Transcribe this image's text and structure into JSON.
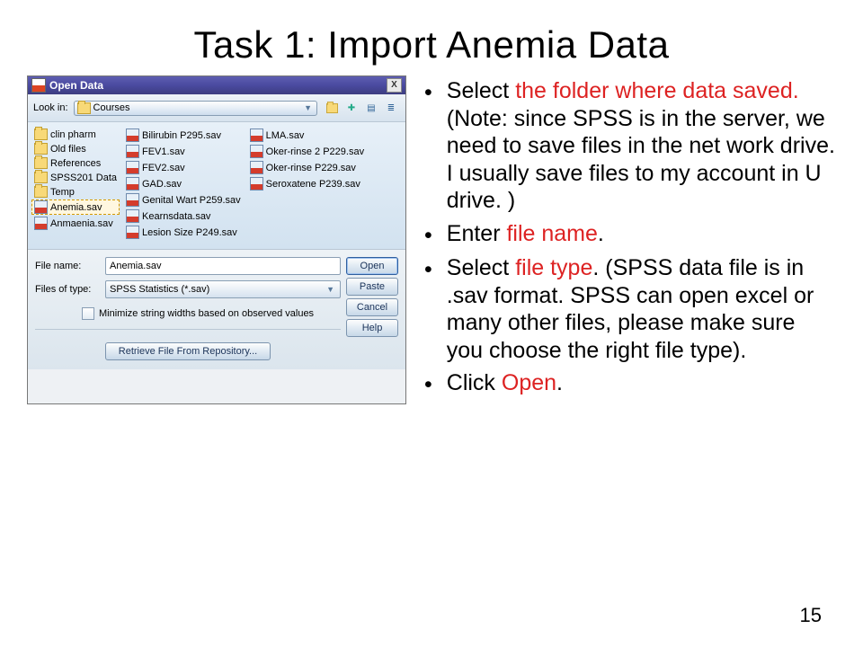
{
  "slide": {
    "title": "Task 1: Import Anemia Data",
    "page_number": "15"
  },
  "dialog": {
    "window_title": "Open Data",
    "look_in_label": "Look in:",
    "look_in_value": "Courses",
    "columns": [
      [
        {
          "name": "clin pharm",
          "type": "folder"
        },
        {
          "name": "Old files",
          "type": "folder"
        },
        {
          "name": "References",
          "type": "folder"
        },
        {
          "name": "SPSS201 Data",
          "type": "folder"
        },
        {
          "name": "Temp",
          "type": "folder"
        },
        {
          "name": "Anemia.sav",
          "type": "sav",
          "selected": true
        },
        {
          "name": "Anmaenia.sav",
          "type": "sav"
        }
      ],
      [
        {
          "name": "Bilirubin P295.sav",
          "type": "sav"
        },
        {
          "name": "FEV1.sav",
          "type": "sav"
        },
        {
          "name": "FEV2.sav",
          "type": "sav"
        },
        {
          "name": "GAD.sav",
          "type": "sav"
        },
        {
          "name": "Genital Wart P259.sav",
          "type": "sav"
        },
        {
          "name": "Kearnsdata.sav",
          "type": "sav"
        },
        {
          "name": "Lesion Size P249.sav",
          "type": "sav"
        }
      ],
      [
        {
          "name": "LMA.sav",
          "type": "sav"
        },
        {
          "name": "Oker-rinse 2 P229.sav",
          "type": "sav"
        },
        {
          "name": "Oker-rinse P229.sav",
          "type": "sav"
        },
        {
          "name": "Seroxatene P239.sav",
          "type": "sav"
        }
      ]
    ],
    "file_name_label": "File name:",
    "file_name_value": "Anemia.sav",
    "file_type_label": "Files of type:",
    "file_type_value": "SPSS Statistics (*.sav)",
    "minimize_label": "Minimize string widths based on observed values",
    "retrieve_label": "Retrieve File From Repository...",
    "buttons": {
      "open": "Open",
      "paste": "Paste",
      "cancel": "Cancel",
      "help": "Help"
    }
  },
  "bullets": [
    {
      "parts": [
        {
          "t": "Select ",
          "c": "black"
        },
        {
          "t": "the folder where data saved.",
          "c": "red"
        },
        {
          "t": " (Note: since SPSS is in the server, we need to save files in the net work drive. I usually save files to my account in U drive. )",
          "c": "black"
        }
      ]
    },
    {
      "parts": [
        {
          "t": "Enter ",
          "c": "black"
        },
        {
          "t": "file name",
          "c": "red"
        },
        {
          "t": ".",
          "c": "black"
        }
      ]
    },
    {
      "parts": [
        {
          "t": "Select ",
          "c": "black"
        },
        {
          "t": "file type",
          "c": "red"
        },
        {
          "t": ". (SPSS data file is in .sav format. SPSS can open excel or many other files, please make sure you choose the right file type).",
          "c": "black"
        }
      ]
    },
    {
      "parts": [
        {
          "t": "Click ",
          "c": "black"
        },
        {
          "t": "Open",
          "c": "red"
        },
        {
          "t": ".",
          "c": "black"
        }
      ]
    }
  ]
}
